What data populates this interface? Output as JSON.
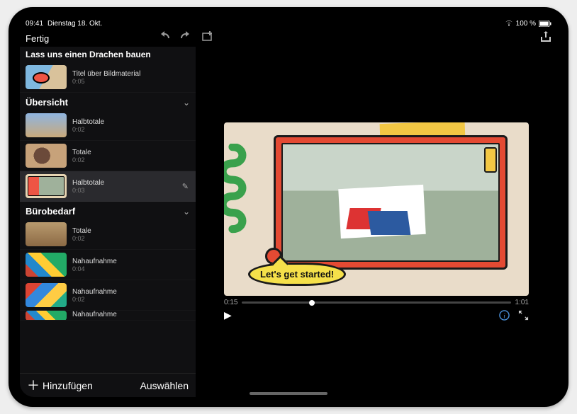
{
  "status_bar": {
    "time": "09:41",
    "date": "Dienstag 18. Okt.",
    "battery_text": "100 %"
  },
  "toolbar": {
    "done_label": "Fertig"
  },
  "project": {
    "title": "Lass uns einen Drachen bauen"
  },
  "title_clip": {
    "label": "Titel über Bildmaterial",
    "duration": "0:05"
  },
  "sections": [
    {
      "title": "Übersicht",
      "clips": [
        {
          "label": "Halbtotale",
          "duration": "0:02"
        },
        {
          "label": "Totale",
          "duration": "0:02"
        },
        {
          "label": "Halbtotale",
          "duration": "0:03",
          "selected": true
        }
      ]
    },
    {
      "title": "Bürobedarf",
      "clips": [
        {
          "label": "Totale",
          "duration": "0:02"
        },
        {
          "label": "Nahaufnahme",
          "duration": "0:04"
        },
        {
          "label": "Nahaufnahme",
          "duration": "0:02"
        },
        {
          "label": "Nahaufnahme",
          "duration": ""
        }
      ]
    }
  ],
  "footer": {
    "add_label": "Hinzufügen",
    "select_label": "Auswählen"
  },
  "preview": {
    "bubble_text": "Let's get started!"
  },
  "playback": {
    "current": "0:15",
    "total": "1:01"
  }
}
